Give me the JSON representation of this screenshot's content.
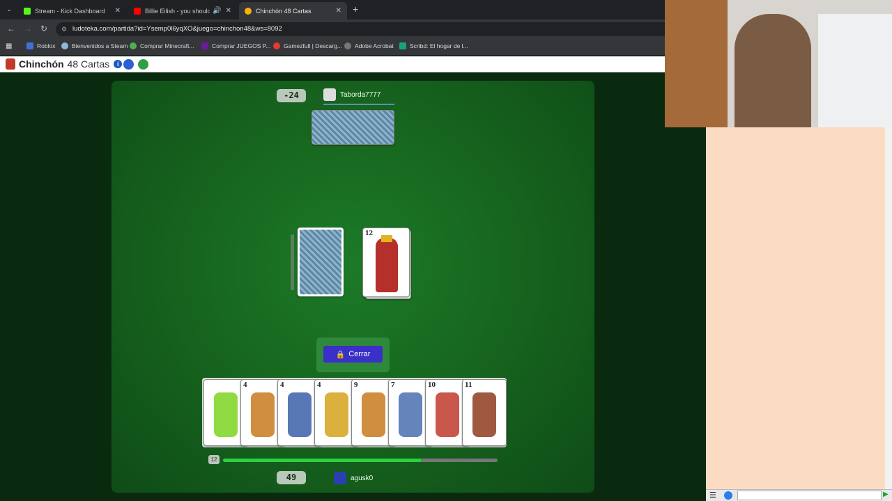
{
  "browser": {
    "tabs": [
      {
        "title": "Stream - Kick Dashboard",
        "color": "#53fc18",
        "active": false
      },
      {
        "title": "Billie Eilish - you should see me in a crown",
        "color": "#ff0000",
        "active": false
      },
      {
        "title": "Chinchón 48 Cartas",
        "color": "#f4b400",
        "active": true
      }
    ],
    "url": "ludoteka.com/partida?id=Ysemp0l6yqXO&juego=chinchon48&ws=8092",
    "bookmarks": [
      {
        "label": "Roblox",
        "color": "#3f6fd8"
      },
      {
        "label": "Bienvenidos a Steam",
        "color": "#1b2838"
      },
      {
        "label": "Comprar Minecraft...",
        "color": "#4caf50"
      },
      {
        "label": "Comprar JUEGOS P...",
        "color": "#6a1b9a"
      },
      {
        "label": "Gamezfull | Descarg...",
        "color": "#e53935"
      },
      {
        "label": "Adobe Acrobat",
        "color": "#777777"
      },
      {
        "label": "Scribd: El hogar de l...",
        "color": "#1aa37a"
      }
    ]
  },
  "site": {
    "title": "Chinchón",
    "subtitle": "48 Cartas",
    "info_glyph": "i"
  },
  "game": {
    "opponent": {
      "name": "Taborda7777",
      "score": "-24",
      "cards_in_hand": 7
    },
    "player": {
      "name": "agusk0",
      "score": "49"
    },
    "discard_top": "12",
    "close_button": "Cerrar",
    "hand": [
      {
        "num": "",
        "suit": "joker",
        "color": "#7dd321"
      },
      {
        "num": "4",
        "suit": "bastos",
        "color": "#c77a1e"
      },
      {
        "num": "4",
        "suit": "caballo",
        "color": "#3a5fa8"
      },
      {
        "num": "4",
        "suit": "oros",
        "color": "#d6a21a"
      },
      {
        "num": "9",
        "suit": "bastos",
        "color": "#c77a1e"
      },
      {
        "num": "7",
        "suit": "espadas",
        "color": "#4a6fb0"
      },
      {
        "num": "10",
        "suit": "sota",
        "color": "#c0392b"
      },
      {
        "num": "11",
        "suit": "caballo",
        "color": "#8e3c1e"
      }
    ],
    "turn_badge": "12",
    "progress_fraction": 0.72
  }
}
